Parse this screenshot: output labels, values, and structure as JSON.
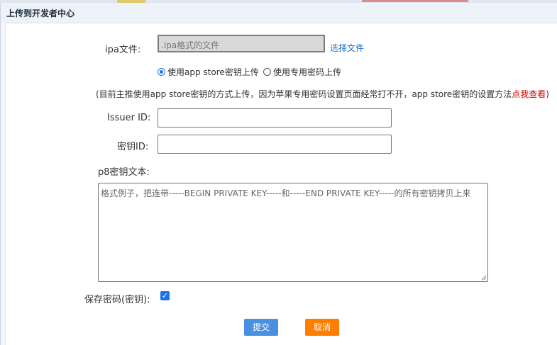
{
  "dialog": {
    "title": "上传到开发者中心"
  },
  "ipa": {
    "label": "ipa文件:",
    "placeholder": ".ipa格式的文件",
    "choose_label": "选择文件"
  },
  "upload_mode": {
    "options": [
      {
        "label": "使用app store密钥上传",
        "selected": true
      },
      {
        "label": "使用专用密码上传",
        "selected": false
      }
    ]
  },
  "note": {
    "text": "(目前主推使用app store密钥的方式上传，因为苹果专用密码设置页面经常打不开，app store密钥的设置方法",
    "link": "点我查看",
    "suffix": ")"
  },
  "issuer": {
    "label": "Issuer ID:",
    "value": ""
  },
  "key_id": {
    "label": "密钥ID:",
    "value": ""
  },
  "p8": {
    "label": "p8密钥文本:",
    "placeholder": "格式例子，把连带-----BEGIN PRIVATE KEY-----和-----END PRIVATE KEY-----的所有密钥拷贝上来"
  },
  "save": {
    "label": "保存密码(密钥):",
    "checked": true
  },
  "buttons": {
    "submit": "提交",
    "cancel": "取消"
  },
  "colors": {
    "primary": "#4a90e2",
    "cancel": "#ff7e00",
    "link": "#1a6fd0",
    "highlight": "#d40000"
  }
}
